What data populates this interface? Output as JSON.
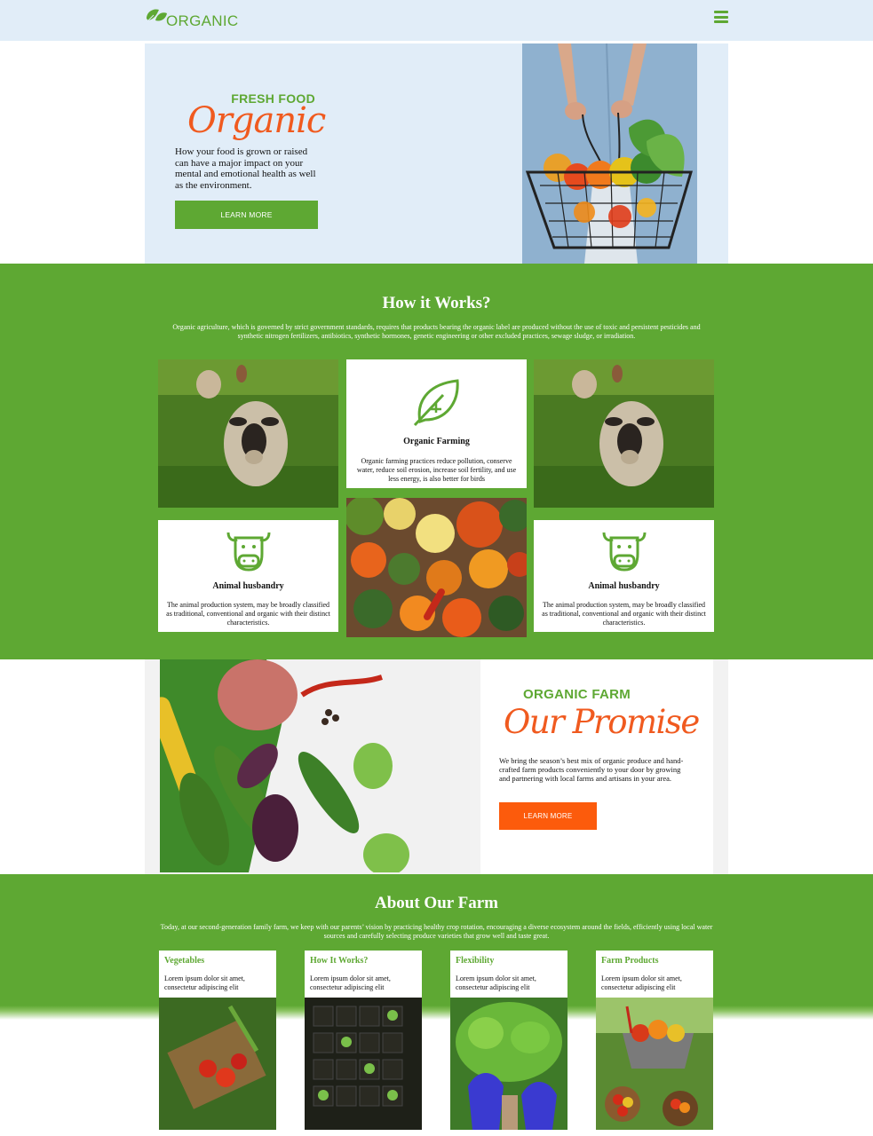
{
  "header": {
    "logo_text": "ORGANIC",
    "logo_icon": "leaf-icon",
    "menu_icon": "hamburger-menu-icon"
  },
  "hero": {
    "kicker": "FRESH FOOD",
    "script_title": "Organic",
    "text": "How your food is grown or raised can have a major impact on your mental and emotional health as well as the environment.",
    "button_label": "LEARN MORE"
  },
  "how": {
    "title": "How it Works?",
    "description": "Organic agriculture, which is governed by strict government standards, requires that products bearing the organic label are produced without the use of toxic and persistent pesticides and synthetic nitrogen fertilizers, antibiotics, synthetic hormones, genetic engineering or other excluded practices, sewage sludge, or irradiation.",
    "cards": [
      {
        "title": "Organic Farming",
        "text": "Organic farming practices reduce pollution, conserve water, reduce soil erosion, increase soil fertility, and use less energy, is also better for birds",
        "icon": "leaf-icon"
      },
      {
        "title": "Animal husbandry",
        "text": "The animal production system, may be broadly classified as traditional, conventional and organic with their distinct characteristics.",
        "icon": "cow-icon"
      },
      {
        "title": "Animal husbandry",
        "text": "The animal production system, may be broadly classified as traditional, conventional and organic with their distinct characteristics.",
        "icon": "cow-icon"
      }
    ]
  },
  "promise": {
    "kicker": "ORGANIC FARM",
    "script_title": "Our Promise",
    "text": "We bring the season’s best mix of organic produce and hand-crafted farm products conveniently to your door by growing and partnering with local farms and artisans in your area.",
    "button_label": "LEARN MORE"
  },
  "about": {
    "title": "About Our Farm",
    "description": "Today, at our second-generation family farm, we keep with our parents’ vision by practicing healthy crop rotation, encouraging a diverse ecosystem around the fields, efficiently using local water sources and carefully selecting produce varieties that grow well and taste great.",
    "cards": [
      {
        "title": "Vegetables",
        "text": "Lorem ipsum dolor sit amet, consectetur adipiscing elit"
      },
      {
        "title": "How It Works?",
        "text": "Lorem ipsum dolor sit amet, consectetur adipiscing elit"
      },
      {
        "title": "Flexibility",
        "text": "Lorem ipsum dolor sit amet, consectetur adipiscing elit"
      },
      {
        "title": "Farm Products",
        "text": "Lorem ipsum dolor sit amet, consectetur adipiscing elit"
      }
    ]
  },
  "colors": {
    "brand_green": "#5ea833",
    "accent_orange": "#f05a1f",
    "button_orange": "#fc5b0c",
    "header_bg": "#e1edf8"
  }
}
